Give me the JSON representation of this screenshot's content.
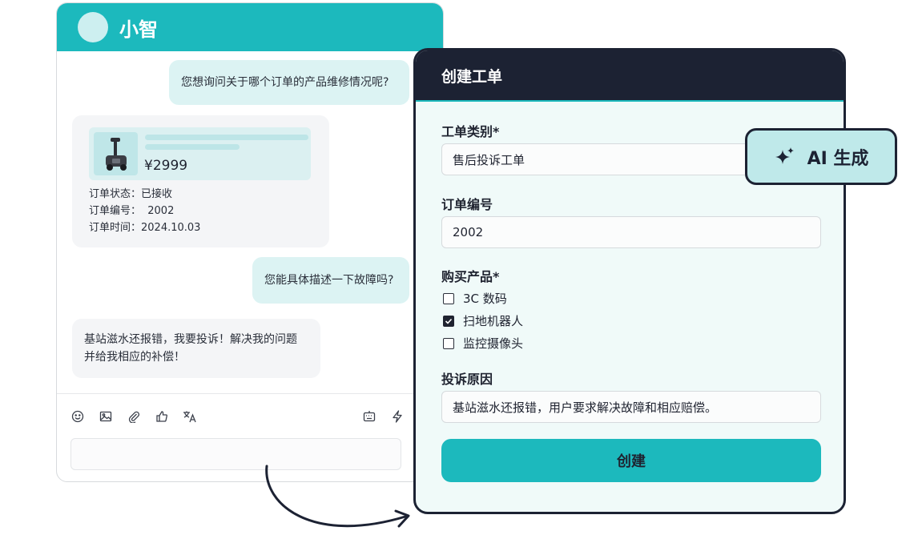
{
  "chat": {
    "title": "小智",
    "messages": {
      "agent_question": "您想询问关于哪个订单的产品维修情况呢?",
      "order_card": {
        "price": "¥2999",
        "status": "订单状态：已接收",
        "number": "订单编号：  2002",
        "time": "订单时间：2024.10.03"
      },
      "agent_question_2": "您能具体描述一下故障吗?",
      "user_complaint_line1": "基站滋水还报错，我要投诉！解决我的问题",
      "user_complaint_line2": "并给我相应的补偿！"
    },
    "toolbar_icons": [
      "emoji-icon",
      "image-icon",
      "attachment-icon",
      "thumbs-up-icon",
      "translate-icon",
      "keyboard-icon",
      "lightning-icon"
    ],
    "input_placeholder": ""
  },
  "ticket": {
    "title": "创建工单",
    "category_label": "工单类别*",
    "category_value": "售后投诉工单",
    "order_label": "订单编号",
    "order_value": "2002",
    "product_label": "购买产品*",
    "products": [
      {
        "label": "3C 数码",
        "checked": false
      },
      {
        "label": "扫地机器人",
        "checked": true
      },
      {
        "label": "监控摄像头",
        "checked": false
      }
    ],
    "reason_label": "投诉原因",
    "reason_value": "基站滋水还报错，用户要求解决故障和相应赔偿。",
    "submit_label": "创建"
  },
  "ai_badge": {
    "label": "AI 生成",
    "icon": "sparkle-icon"
  },
  "colors": {
    "accent": "#1cb9bd",
    "dark": "#1c2233",
    "panel_bg": "#f0faf9"
  }
}
